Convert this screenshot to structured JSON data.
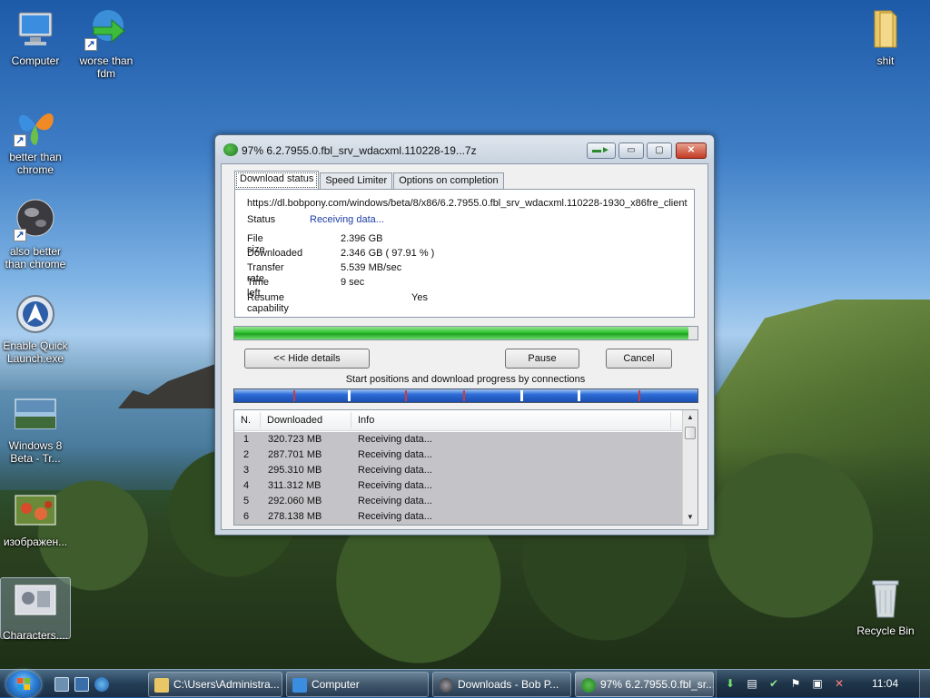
{
  "desktop": {
    "icons": [
      {
        "label": "Computer",
        "icon": "computer-icon"
      },
      {
        "label": "worse than fdm",
        "icon": "idm-icon"
      },
      {
        "label": "better than chrome",
        "icon": "ie-butterfly-icon"
      },
      {
        "label": "also better than chrome",
        "icon": "globe-icon"
      },
      {
        "label": "Enable Quick Launch.exe",
        "icon": "quick-launch-icon"
      },
      {
        "label": "Windows 8 Beta - Tr...",
        "icon": "image-thumbnail-icon"
      },
      {
        "label": "изображен...",
        "icon": "image-thumbnail-icon"
      },
      {
        "label": "Characters....",
        "icon": "image-thumbnail-icon"
      },
      {
        "label": "shit",
        "icon": "folder-icon"
      },
      {
        "label": "Recycle Bin",
        "icon": "recycle-bin-icon"
      }
    ]
  },
  "window": {
    "title": "97% 6.2.7955.0.fbl_srv_wdacxml.110228-19...7z",
    "tabs": [
      "Download status",
      "Speed Limiter",
      "Options on completion"
    ],
    "url": "https://dl.bobpony.com/windows/beta/8/x86/6.2.7955.0.fbl_srv_wdacxml.110228-1930_x86fre_client",
    "status_label": "Status",
    "status_value": "Receiving data...",
    "fields": [
      {
        "label": "File size",
        "value": "2.396  GB"
      },
      {
        "label": "Downloaded",
        "value": "2.346  GB  ( 97.91 % )"
      },
      {
        "label": "Transfer rate",
        "value": "5.539  MB/sec"
      },
      {
        "label": "Time left",
        "value": "9 sec"
      },
      {
        "label": "Resume capability",
        "value": "Yes"
      }
    ],
    "progress_fraction": 0.98,
    "hide_details_label": "<< Hide details",
    "pause_label": "Pause",
    "cancel_label": "Cancel",
    "connections_caption": "Start positions and download progress by connections",
    "list_headers": [
      "N.",
      "Downloaded",
      "Info"
    ],
    "connections": [
      {
        "n": "1",
        "downloaded": "320.723  MB",
        "info": "Receiving data..."
      },
      {
        "n": "2",
        "downloaded": "287.701  MB",
        "info": "Receiving data..."
      },
      {
        "n": "3",
        "downloaded": "295.310  MB",
        "info": "Receiving data..."
      },
      {
        "n": "4",
        "downloaded": "311.312  MB",
        "info": "Receiving data..."
      },
      {
        "n": "5",
        "downloaded": "292.060  MB",
        "info": "Receiving data..."
      },
      {
        "n": "6",
        "downloaded": "278.138  MB",
        "info": "Receiving data..."
      }
    ]
  },
  "taskbar": {
    "tasks": [
      {
        "label": "C:\\Users\\Administra...",
        "icon": "folder-icon"
      },
      {
        "label": "Computer",
        "icon": "computer-icon"
      },
      {
        "label": "Downloads - Bob P...",
        "icon": "globe-icon"
      },
      {
        "label": "97% 6.2.7955.0.fbl_sr...",
        "icon": "idm-icon"
      }
    ],
    "clock": "11:04"
  },
  "colors": {
    "status_blue": "#1b3fa6",
    "progress_green": "#2ec42e",
    "connections_blue": "#2c6cd8"
  }
}
